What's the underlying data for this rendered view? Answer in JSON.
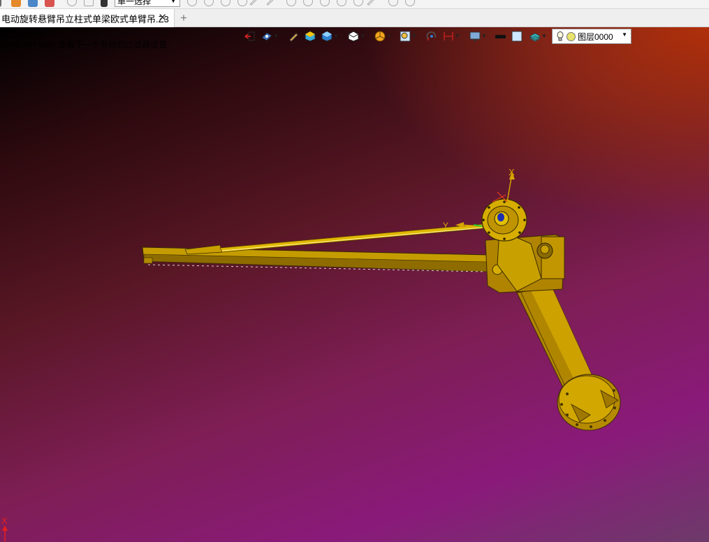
{
  "ribbon": {
    "selection_filter": "单一选择"
  },
  "document_tab": {
    "title": "电动旋转悬臂吊立柱式单梁欧式单臂吊.Z3",
    "close_symbol": "✕",
    "add_symbol": "+"
  },
  "viewport": {
    "status_line1": "已加载完毕",
    "status_line2": "按 <Shift+Tab> 查看下一个有效的过滤器设置.",
    "layer_name": "图层0000",
    "axis_labels": {
      "model_x": "X",
      "model_y": "Y",
      "triad_x": "X"
    },
    "background_colors": {
      "top_left": "#000000",
      "top_right": "#b0300a",
      "bottom_left": "#8a1a7a",
      "bottom_right": "#6d3a6a"
    },
    "model_color": "#c8a000"
  },
  "view_toolbar": {
    "icons": [
      "exit-sketch-icon",
      "view-orientation-icon",
      "pen-icon",
      "shaded-solid-icon",
      "shaded-box-icon",
      "wireframe-cube-icon",
      "section-view-icon",
      "zoom-fit-icon",
      "reorient-icon",
      "dimension-icon",
      "display-monitor-icon",
      "line-color-icon",
      "fill-color-icon",
      "layer-stack-icon",
      "light-bulb-icon"
    ]
  }
}
